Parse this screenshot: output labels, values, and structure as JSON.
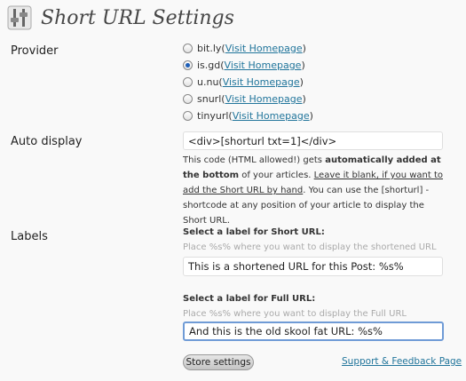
{
  "page": {
    "title": "Short URL Settings"
  },
  "provider": {
    "label": "Provider",
    "options": [
      {
        "name": "bit.ly",
        "open": " (",
        "link": "Visit Homepage",
        "close": ")",
        "selected": false
      },
      {
        "name": "is.gd",
        "open": " (",
        "link": "Visit Homepage",
        "close": ")",
        "selected": true
      },
      {
        "name": "u.nu",
        "open": " (",
        "link": "Visit Homepage",
        "close": ")",
        "selected": false
      },
      {
        "name": "snurl",
        "open": " (",
        "link": "Visit Homepage",
        "close": ")",
        "selected": false
      },
      {
        "name": "tinyurl",
        "open": " (",
        "link": "Visit Homepage",
        "close": ")",
        "selected": false
      }
    ]
  },
  "auto_display": {
    "label": "Auto display",
    "value": "<div>[shorturl txt=1]</div>",
    "desc_1": "This code (HTML allowed!) gets ",
    "desc_bold": "automatically added at the bottom",
    "desc_2": " of your articles. ",
    "desc_link": "Leave it blank, if you want to add the Short URL by hand",
    "desc_3": ". You can use the [shorturl] - shortcode at any position of your article to display the Short URL."
  },
  "labels": {
    "label": "Labels",
    "short_title": "Select a label for Short URL:",
    "short_hint": "Place %s% where you want to display the shortened URL",
    "short_value": "This is a shortened URL for this Post: %s%",
    "full_title": "Select a label for Full URL:",
    "full_hint": "Place %s% where you want to display the Full URL",
    "full_value": "And this is the old skool fat URL: %s%"
  },
  "actions": {
    "store": "Store settings",
    "support": "Support & Feedback Page"
  },
  "colors": {
    "accent": "#21759b",
    "radio_selected": "#1e5fb8",
    "focus_border": "#6f9bd6"
  },
  "icons": {
    "title": "settings-sliders-icon"
  }
}
